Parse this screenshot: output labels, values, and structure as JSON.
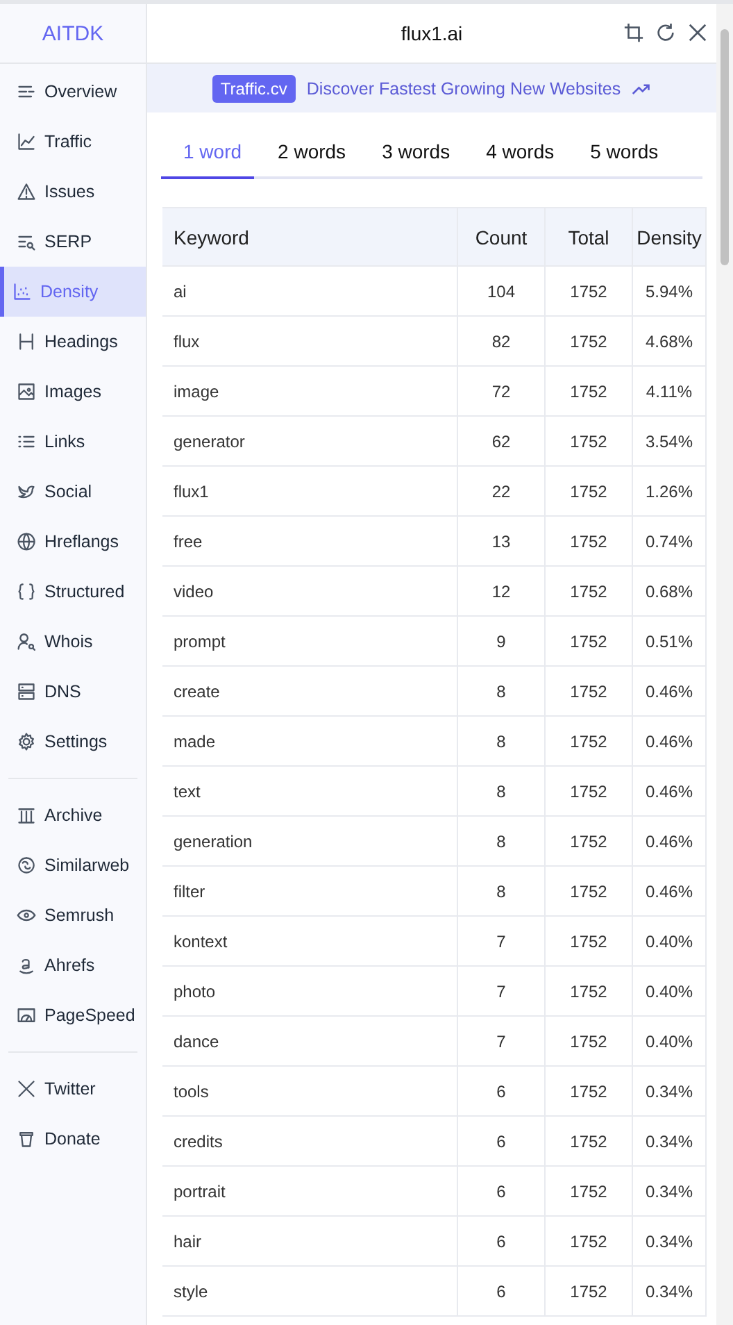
{
  "sidebar": {
    "logo": "AITDK",
    "groups": [
      [
        {
          "label": "Overview",
          "selected": false
        },
        {
          "label": "Traffic",
          "selected": false
        },
        {
          "label": "Issues",
          "selected": false
        },
        {
          "label": "SERP",
          "selected": false
        },
        {
          "label": "Density",
          "selected": true
        },
        {
          "label": "Headings",
          "selected": false
        },
        {
          "label": "Images",
          "selected": false
        },
        {
          "label": "Links",
          "selected": false
        },
        {
          "label": "Social",
          "selected": false
        },
        {
          "label": "Hreflangs",
          "selected": false
        },
        {
          "label": "Structured",
          "selected": false
        },
        {
          "label": "Whois",
          "selected": false
        },
        {
          "label": "DNS",
          "selected": false
        },
        {
          "label": "Settings",
          "selected": false
        }
      ],
      [
        {
          "label": "Archive",
          "selected": false
        },
        {
          "label": "Similarweb",
          "selected": false
        },
        {
          "label": "Semrush",
          "selected": false
        },
        {
          "label": "Ahrefs",
          "selected": false
        },
        {
          "label": "PageSpeed",
          "selected": false
        }
      ],
      [
        {
          "label": "Twitter",
          "selected": false
        },
        {
          "label": "Donate",
          "selected": false
        }
      ]
    ]
  },
  "header": {
    "title": "flux1.ai"
  },
  "banner": {
    "badge": "Traffic.cv",
    "text": "Discover Fastest Growing New Websites"
  },
  "tabs": [
    {
      "label": "1 word",
      "selected": true
    },
    {
      "label": "2 words",
      "selected": false
    },
    {
      "label": "3 words",
      "selected": false
    },
    {
      "label": "4 words",
      "selected": false
    },
    {
      "label": "5 words",
      "selected": false
    }
  ],
  "table": {
    "columns": [
      "Keyword",
      "Count",
      "Total",
      "Density"
    ],
    "rows": [
      [
        "ai",
        "104",
        "1752",
        "5.94%"
      ],
      [
        "flux",
        "82",
        "1752",
        "4.68%"
      ],
      [
        "image",
        "72",
        "1752",
        "4.11%"
      ],
      [
        "generator",
        "62",
        "1752",
        "3.54%"
      ],
      [
        "flux1",
        "22",
        "1752",
        "1.26%"
      ],
      [
        "free",
        "13",
        "1752",
        "0.74%"
      ],
      [
        "video",
        "12",
        "1752",
        "0.68%"
      ],
      [
        "prompt",
        "9",
        "1752",
        "0.51%"
      ],
      [
        "create",
        "8",
        "1752",
        "0.46%"
      ],
      [
        "made",
        "8",
        "1752",
        "0.46%"
      ],
      [
        "text",
        "8",
        "1752",
        "0.46%"
      ],
      [
        "generation",
        "8",
        "1752",
        "0.46%"
      ],
      [
        "filter",
        "8",
        "1752",
        "0.46%"
      ],
      [
        "kontext",
        "7",
        "1752",
        "0.40%"
      ],
      [
        "photo",
        "7",
        "1752",
        "0.40%"
      ],
      [
        "dance",
        "7",
        "1752",
        "0.40%"
      ],
      [
        "tools",
        "6",
        "1752",
        "0.34%"
      ],
      [
        "credits",
        "6",
        "1752",
        "0.34%"
      ],
      [
        "portrait",
        "6",
        "1752",
        "0.34%"
      ],
      [
        "hair",
        "6",
        "1752",
        "0.34%"
      ],
      [
        "style",
        "6",
        "1752",
        "0.34%"
      ]
    ]
  }
}
